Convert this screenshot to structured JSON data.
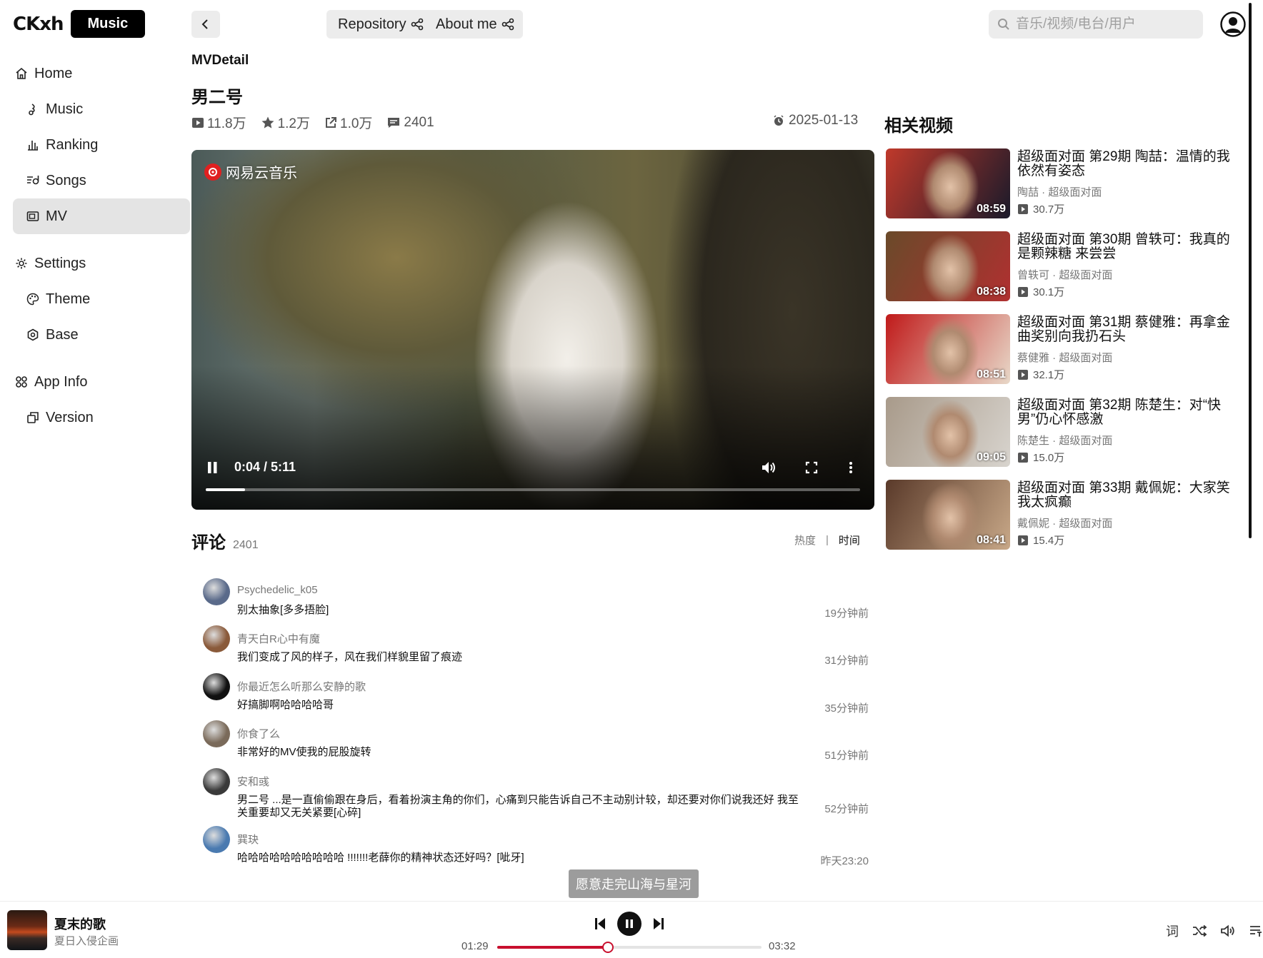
{
  "app": {
    "logo_text": "CKxh",
    "logo_badge": "Music"
  },
  "sidebar": {
    "groups": [
      {
        "label": "Home",
        "icon": "home-icon",
        "items": [
          {
            "label": "Music",
            "icon": "music-note-icon"
          },
          {
            "label": "Ranking",
            "icon": "ranking-icon"
          },
          {
            "label": "Songs",
            "icon": "playlist-icon"
          },
          {
            "label": "MV",
            "icon": "video-icon",
            "active": true
          }
        ]
      },
      {
        "label": "Settings",
        "icon": "gear-icon",
        "items": [
          {
            "label": "Theme",
            "icon": "palette-icon"
          },
          {
            "label": "Base",
            "icon": "hexagon-icon"
          }
        ]
      },
      {
        "label": "App Info",
        "icon": "grid-icon",
        "items": [
          {
            "label": "Version",
            "icon": "version-icon"
          }
        ]
      }
    ]
  },
  "topbar": {
    "repository_label": "Repository",
    "about_label": "About me",
    "search_placeholder": "音乐/视频/电台/用户"
  },
  "mv": {
    "breadcrumb": "MVDetail",
    "title": "男二号",
    "plays": "11.8万",
    "likes": "1.2万",
    "shares": "1.0万",
    "comments": "2401",
    "date": "2025-01-13",
    "video": {
      "watermark": "网易云音乐",
      "time": "0:04 / 5:11",
      "progress": 0.013
    }
  },
  "comments": {
    "title": "评论",
    "count": "2401",
    "sort_hot": "热度",
    "sort_sep": "|",
    "sort_time": "时间",
    "items": [
      {
        "user": "Psychedelic_k05",
        "text": "别太抽象[多多捂脸]",
        "time": "19分钟前",
        "avatar_color": "#5a6a8a"
      },
      {
        "user": "青天白R心中有魔",
        "text": "我们变成了风的样子，风在我们样貌里留了痕迹",
        "time": "31分钟前",
        "avatar_color": "#8a5a3a"
      },
      {
        "user": "你最近怎么听那么安静的歌",
        "text": "好搞脚啊哈哈哈哈哥",
        "time": "35分钟前",
        "avatar_color": "#111111"
      },
      {
        "user": "你食了么",
        "text": "非常好的MV使我的屁股旋转",
        "time": "51分钟前",
        "avatar_color": "#7a6a5a"
      },
      {
        "user": "安和彧",
        "text": "男二号 ...是一直偷偷跟在身后，看着扮演主角的你们，心痛到只能告诉自己不主动别计较，却还要对你们说我还好 我至关重要却又无关紧要[心碎]",
        "time": "52分钟前",
        "avatar_color": "#3a3a3a"
      },
      {
        "user": "巽玦",
        "text": "哈哈哈哈哈哈哈哈哈哈 !!!!!!!老薛你的精神状态还好吗？[呲牙]",
        "time": "昨天23:20",
        "avatar_color": "#4a7ab0"
      }
    ]
  },
  "toast": "愿意走完山海与星河",
  "related": {
    "title": "相关视频",
    "items": [
      {
        "name": "超级面对面 第29期 陶喆：温情的我依然有姿态",
        "artist": "陶喆 · 超级面对面",
        "plays": "30.7万",
        "duration": "08:59",
        "color1": "#c0392b",
        "color2": "#1a1a2a"
      },
      {
        "name": "超级面对面 第30期 曾轶可：我真的是颗辣糖 来尝尝",
        "artist": "曾轶可 · 超级面对面",
        "plays": "30.1万",
        "duration": "08:38",
        "color1": "#6a4a2a",
        "color2": "#b03030"
      },
      {
        "name": "超级面对面 第31期 蔡健雅：再拿金曲奖别向我扔石头",
        "artist": "蔡健雅 · 超级面对面",
        "plays": "32.1万",
        "duration": "08:51",
        "color1": "#c01a1a",
        "color2": "#e8d8c8"
      },
      {
        "name": "超级面对面 第32期 陈楚生：对“快男”仍心怀感激",
        "artist": "陈楚生 · 超级面对面",
        "plays": "15.0万",
        "duration": "09:05",
        "color1": "#a89a8a",
        "color2": "#d8d4ce"
      },
      {
        "name": "超级面对面 第33期 戴佩妮：大家笑我太疯癫",
        "artist": "戴佩妮 · 超级面对面",
        "plays": "15.4万",
        "duration": "08:41",
        "color1": "#5a3a2a",
        "color2": "#c8a888"
      }
    ]
  },
  "player": {
    "song": "夏末的歌",
    "artist": "夏日入侵企画",
    "current": "01:29",
    "total": "03:32",
    "progress": 0.42,
    "lyric_label": "词",
    "accent": "#c8102e"
  }
}
